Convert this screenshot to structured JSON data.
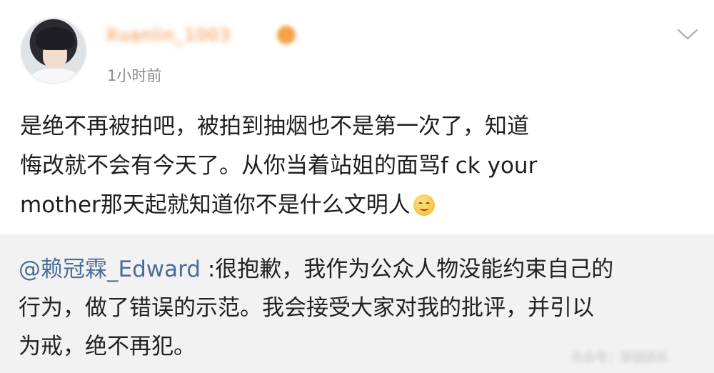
{
  "post": {
    "username": "Xuanlin_1003",
    "timestamp": "1小时前",
    "lines": [
      "是绝不再被拍吧，被拍到抽烟也不是第一次了，知道",
      "悔改就不会有今天了。从你当着站姐的面骂f ck your",
      "mother那天起就知道你不是什么文明人"
    ],
    "emoji": "smiling-face-emoji"
  },
  "reply": {
    "mention": "@赖冠霖_Edward",
    "line1_rest": " :很抱歉，我作为公众人物没能约束自己的",
    "line2": "行为，做了错误的示范。我会接受大家对我的批评，并引以",
    "line3": "为戒，绝不再犯。"
  },
  "watermark": "头条号：添福娱乐",
  "icons": {
    "menu": "chevron-down-icon",
    "verified": "badge-icon"
  },
  "colors": {
    "mention": "#4a6d99",
    "username": "#f08a3a",
    "reply_bg": "#f2f2f2"
  }
}
